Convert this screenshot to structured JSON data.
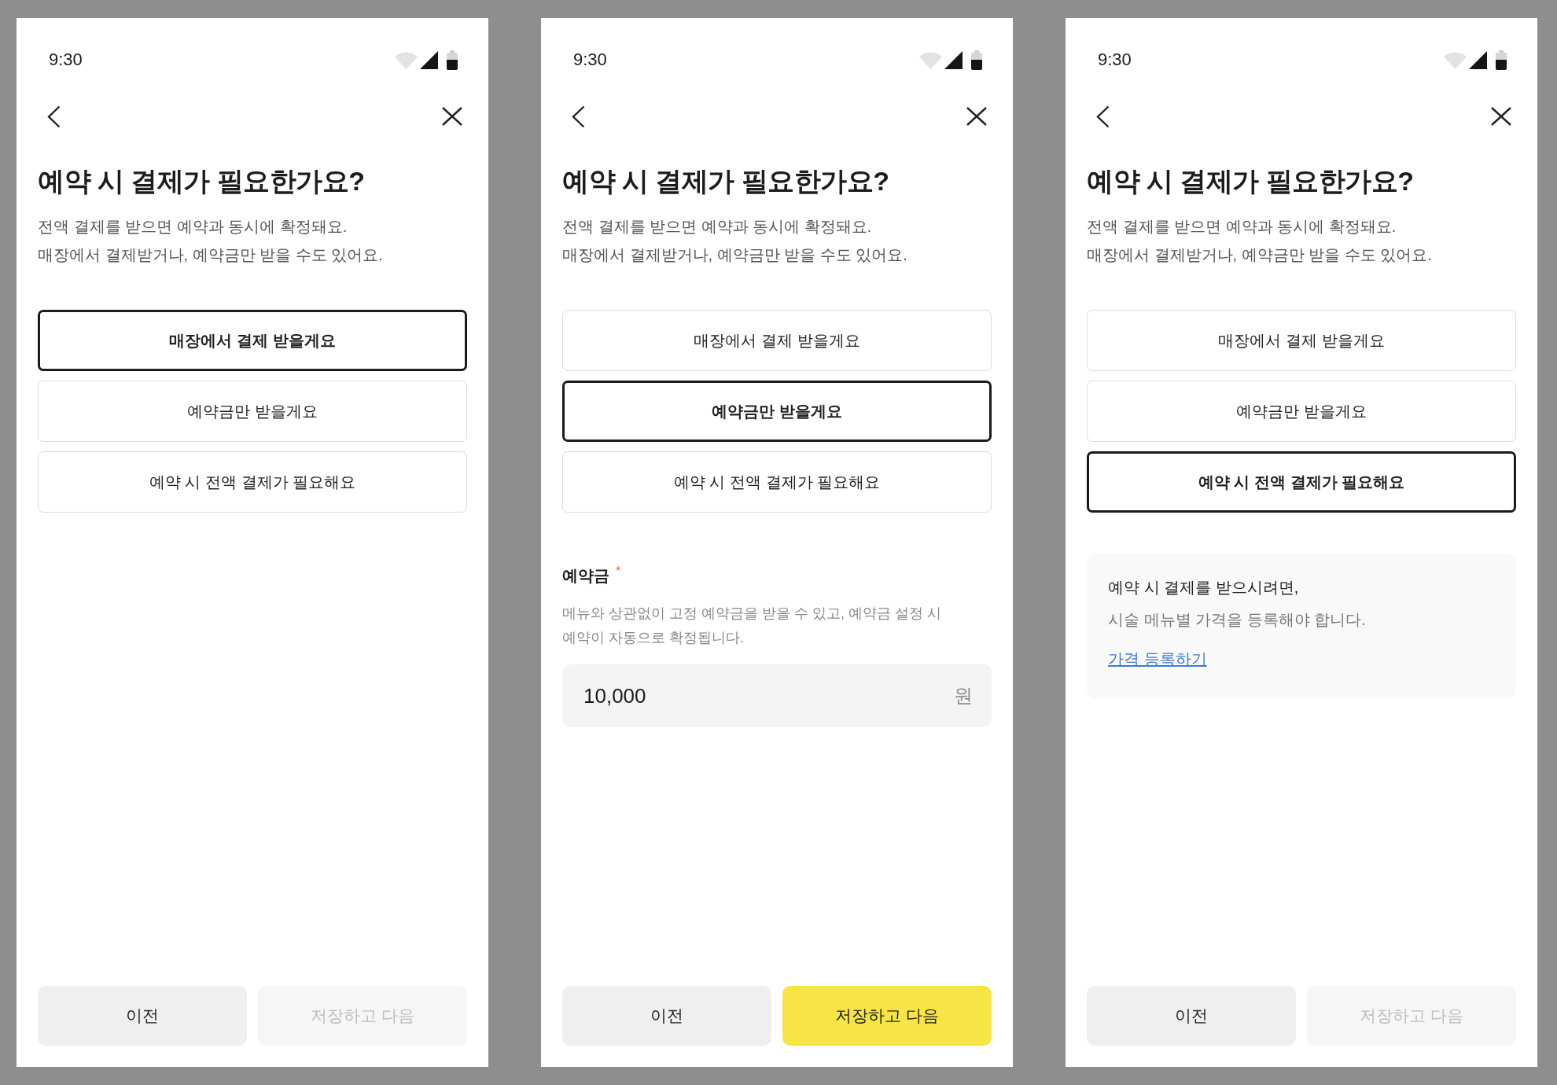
{
  "screens": [
    {
      "status_bar": {
        "time": "9:30"
      },
      "title": "예약 시 결제가 필요한가요?",
      "description": [
        "전액 결제를 받으면 예약과 동시에 확정돼요.",
        "매장에서 결제받거나, 예약금만 받을 수도 있어요."
      ],
      "options": [
        {
          "label": "매장에서 결제 받을게요",
          "selected": true
        },
        {
          "label": "예약금만 받을게요",
          "selected": false
        },
        {
          "label": "예약 시 전액 결제가 필요해요",
          "selected": false
        }
      ],
      "buttons": [
        {
          "label": "이전",
          "kind": "secondary",
          "disabled": false
        },
        {
          "label": "저장하고 다음",
          "kind": "primary",
          "disabled": true
        }
      ]
    },
    {
      "status_bar": {
        "time": "9:30"
      },
      "title": "예약 시 결제가 필요한가요?",
      "description": [
        "전액 결제를 받으면 예약과 동시에 확정돼요.",
        "매장에서 결제받거나, 예약금만 받을 수도 있어요."
      ],
      "options": [
        {
          "label": "매장에서 결제 받을게요",
          "selected": false
        },
        {
          "label": "예약금만 받을게요",
          "selected": true
        },
        {
          "label": "예약 시 전액 결제가 필요해요",
          "selected": false
        }
      ],
      "deposit": {
        "label": "예약금",
        "required_mark": "*",
        "help": [
          "메뉴와 상관없이 고정 예약금을 받을 수 있고, 예약금 설정 시",
          "예약이 자동으로 확정됩니다."
        ],
        "value": "10,000",
        "unit": "원"
      },
      "buttons": [
        {
          "label": "이전",
          "kind": "secondary",
          "disabled": false
        },
        {
          "label": "저장하고 다음",
          "kind": "primary",
          "disabled": false
        }
      ]
    },
    {
      "status_bar": {
        "time": "9:30"
      },
      "title": "예약 시 결제가 필요한가요?",
      "description": [
        "전액 결제를 받으면 예약과 동시에 확정돼요.",
        "매장에서 결제받거나, 예약금만 받을 수도 있어요."
      ],
      "options": [
        {
          "label": "매장에서 결제 받을게요",
          "selected": false
        },
        {
          "label": "예약금만 받을게요",
          "selected": false
        },
        {
          "label": "예약 시 전액 결제가 필요해요",
          "selected": true
        }
      ],
      "notice": {
        "heading": "예약 시 결제를 받으시려면,",
        "text": "시술 메뉴별 가격을 등록해야 합니다.",
        "link": "가격 등록하기"
      },
      "buttons": [
        {
          "label": "이전",
          "kind": "secondary",
          "disabled": false
        },
        {
          "label": "저장하고 다음",
          "kind": "primary",
          "disabled": true
        }
      ]
    }
  ]
}
